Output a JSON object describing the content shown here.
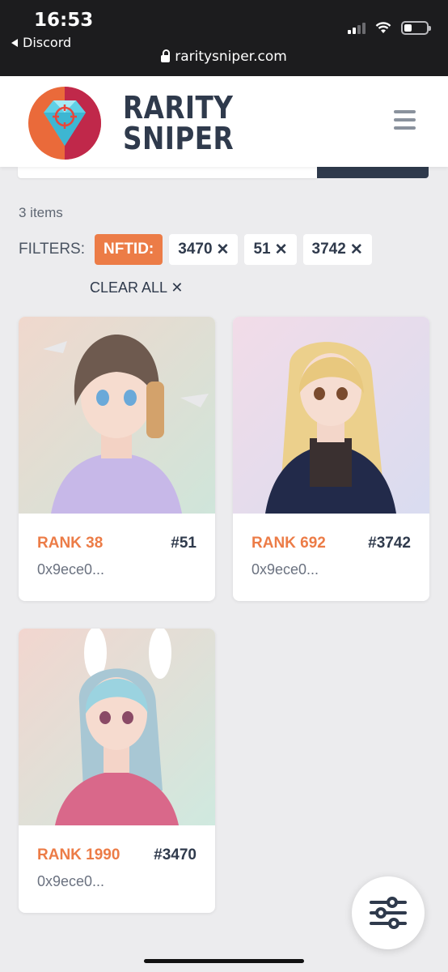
{
  "status_bar": {
    "time": "16:53",
    "back_app": "Discord",
    "url": "raritysniper.com"
  },
  "header": {
    "brand_line1": "RARITY",
    "brand_line2": "SNIPER",
    "menu_icon": "hamburger-icon"
  },
  "results": {
    "count_text": "3 items"
  },
  "filters": {
    "label": "FILTERS:",
    "category_chip": "NFTID:",
    "chips": [
      "3470",
      "51",
      "3742"
    ],
    "remove_symbol": "✕",
    "clear_all": "CLEAR ALL ✕"
  },
  "cards": [
    {
      "rank": "RANK 38",
      "id": "#51",
      "owner": "0x9ece0..."
    },
    {
      "rank": "RANK 692",
      "id": "#3742",
      "owner": "0x9ece0..."
    },
    {
      "rank": "RANK 1990",
      "id": "#3470",
      "owner": "0x9ece0..."
    }
  ],
  "colors": {
    "accent": "#ec7c47",
    "navy": "#2f3a4c",
    "background": "#ececee"
  },
  "fab": {
    "icon": "sliders-icon"
  }
}
